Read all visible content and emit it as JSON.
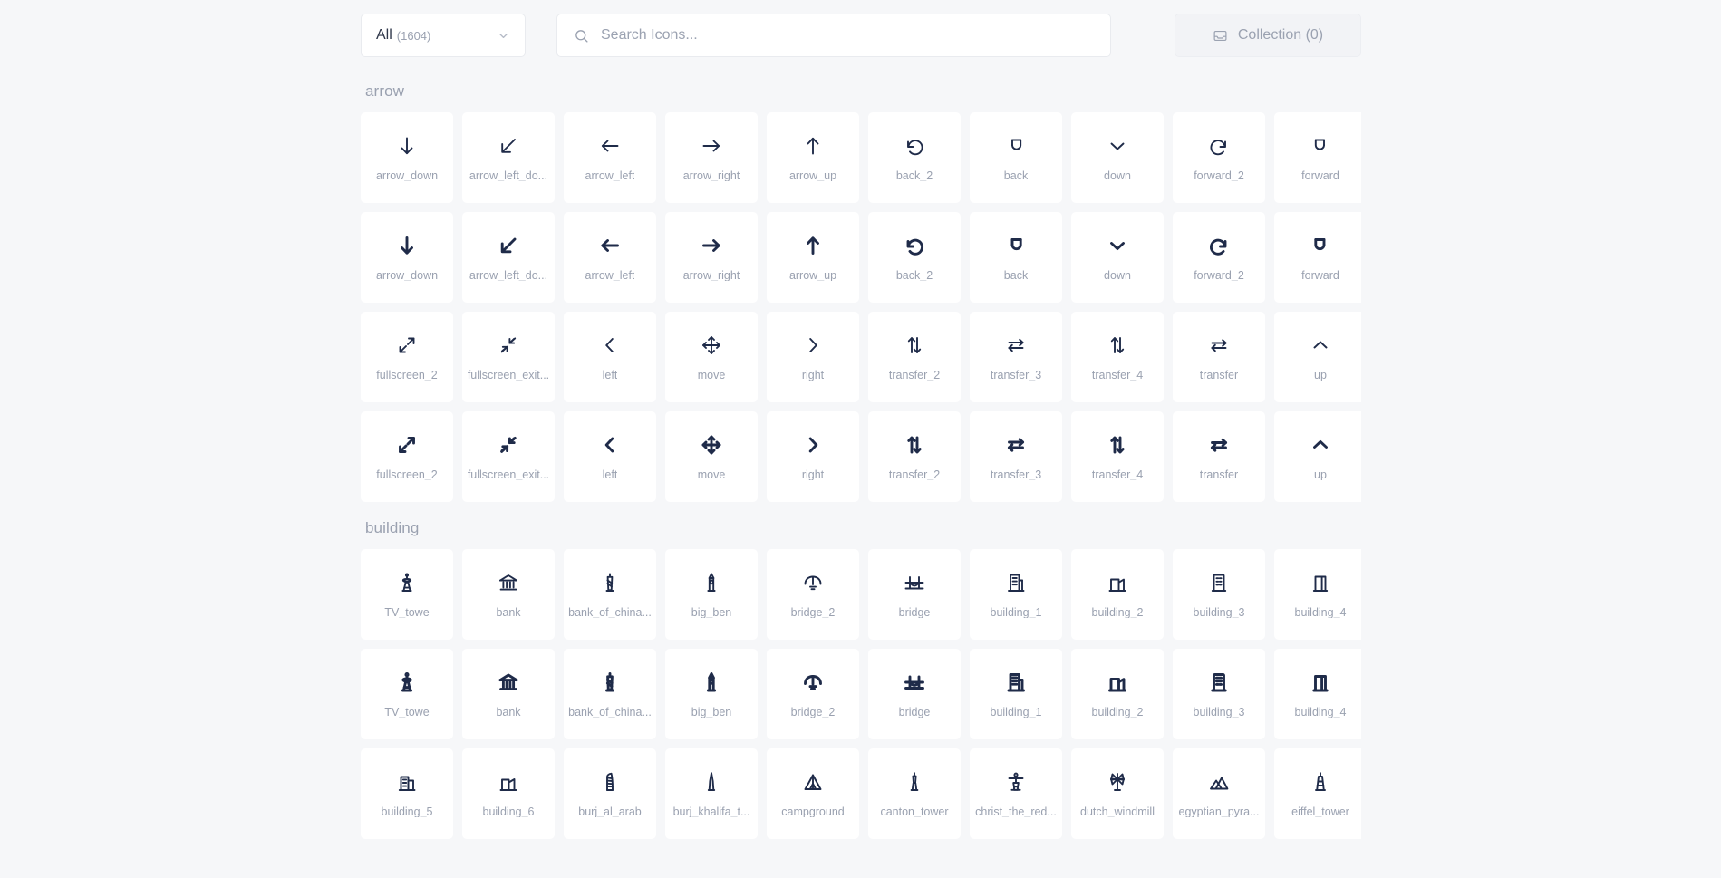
{
  "toolbar": {
    "filter": {
      "label": "All",
      "count": "(1604)",
      "caret_icon": "chevron-down-icon"
    },
    "search": {
      "placeholder": "Search Icons...",
      "value": "",
      "icon": "search-icon"
    },
    "collection": {
      "label": "Collection (0)",
      "icon": "inbox-icon"
    }
  },
  "sections": [
    {
      "title": "arrow",
      "rows": [
        {
          "style": "outline",
          "icons": [
            {
              "name": "arrow_down",
              "glyph": "arrow-down"
            },
            {
              "name": "arrow_left_do...",
              "glyph": "arrow-down-left"
            },
            {
              "name": "arrow_left",
              "glyph": "arrow-left"
            },
            {
              "name": "arrow_right",
              "glyph": "arrow-right"
            },
            {
              "name": "arrow_up",
              "glyph": "arrow-up"
            },
            {
              "name": "back_2",
              "glyph": "undo"
            },
            {
              "name": "back",
              "glyph": "back-loop"
            },
            {
              "name": "down",
              "glyph": "chevron-down"
            },
            {
              "name": "forward_2",
              "glyph": "redo"
            },
            {
              "name": "forward",
              "glyph": "forward-loop"
            }
          ]
        },
        {
          "style": "filled",
          "icons": [
            {
              "name": "arrow_down",
              "glyph": "arrow-down"
            },
            {
              "name": "arrow_left_do...",
              "glyph": "arrow-down-left"
            },
            {
              "name": "arrow_left",
              "glyph": "arrow-left"
            },
            {
              "name": "arrow_right",
              "glyph": "arrow-right"
            },
            {
              "name": "arrow_up",
              "glyph": "arrow-up"
            },
            {
              "name": "back_2",
              "glyph": "undo"
            },
            {
              "name": "back",
              "glyph": "back-loop"
            },
            {
              "name": "down",
              "glyph": "chevron-down"
            },
            {
              "name": "forward_2",
              "glyph": "redo"
            },
            {
              "name": "forward",
              "glyph": "forward-loop"
            }
          ]
        },
        {
          "style": "outline",
          "icons": [
            {
              "name": "fullscreen_2",
              "glyph": "fullscreen"
            },
            {
              "name": "fullscreen_exit...",
              "glyph": "fullscreen-exit"
            },
            {
              "name": "left",
              "glyph": "chevron-left"
            },
            {
              "name": "move",
              "glyph": "move"
            },
            {
              "name": "right",
              "glyph": "chevron-right"
            },
            {
              "name": "transfer_2",
              "glyph": "transfer-2"
            },
            {
              "name": "transfer_3",
              "glyph": "transfer-3"
            },
            {
              "name": "transfer_4",
              "glyph": "transfer-4"
            },
            {
              "name": "transfer",
              "glyph": "transfer"
            },
            {
              "name": "up",
              "glyph": "chevron-up"
            }
          ]
        },
        {
          "style": "filled",
          "icons": [
            {
              "name": "fullscreen_2",
              "glyph": "fullscreen"
            },
            {
              "name": "fullscreen_exit...",
              "glyph": "fullscreen-exit"
            },
            {
              "name": "left",
              "glyph": "chevron-left"
            },
            {
              "name": "move",
              "glyph": "move"
            },
            {
              "name": "right",
              "glyph": "chevron-right"
            },
            {
              "name": "transfer_2",
              "glyph": "transfer-2"
            },
            {
              "name": "transfer_3",
              "glyph": "transfer-3"
            },
            {
              "name": "transfer_4",
              "glyph": "transfer-4"
            },
            {
              "name": "transfer",
              "glyph": "transfer"
            },
            {
              "name": "up",
              "glyph": "chevron-up"
            }
          ]
        }
      ]
    },
    {
      "title": "building",
      "rows": [
        {
          "style": "outline",
          "icons": [
            {
              "name": "TV_towe",
              "glyph": "tv-tower"
            },
            {
              "name": "bank",
              "glyph": "bank"
            },
            {
              "name": "bank_of_china...",
              "glyph": "bank-of-china"
            },
            {
              "name": "big_ben",
              "glyph": "big-ben"
            },
            {
              "name": "bridge_2",
              "glyph": "bridge-2"
            },
            {
              "name": "bridge",
              "glyph": "bridge"
            },
            {
              "name": "building_1",
              "glyph": "building-1"
            },
            {
              "name": "building_2",
              "glyph": "building-2"
            },
            {
              "name": "building_3",
              "glyph": "building-3"
            },
            {
              "name": "building_4",
              "glyph": "building-4"
            }
          ]
        },
        {
          "style": "filled",
          "icons": [
            {
              "name": "TV_towe",
              "glyph": "tv-tower"
            },
            {
              "name": "bank",
              "glyph": "bank"
            },
            {
              "name": "bank_of_china...",
              "glyph": "bank-of-china"
            },
            {
              "name": "big_ben",
              "glyph": "big-ben"
            },
            {
              "name": "bridge_2",
              "glyph": "bridge-2"
            },
            {
              "name": "bridge",
              "glyph": "bridge"
            },
            {
              "name": "building_1",
              "glyph": "building-1"
            },
            {
              "name": "building_2",
              "glyph": "building-2"
            },
            {
              "name": "building_3",
              "glyph": "building-3"
            },
            {
              "name": "building_4",
              "glyph": "building-4"
            }
          ]
        },
        {
          "style": "outline",
          "icons": [
            {
              "name": "building_5",
              "glyph": "building-5"
            },
            {
              "name": "building_6",
              "glyph": "building-6"
            },
            {
              "name": "burj_al_arab",
              "glyph": "burj-al-arab"
            },
            {
              "name": "burj_khalifa_t...",
              "glyph": "burj-khalifa"
            },
            {
              "name": "campground",
              "glyph": "campground"
            },
            {
              "name": "canton_tower",
              "glyph": "canton-tower"
            },
            {
              "name": "christ_the_red...",
              "glyph": "christ-redeemer"
            },
            {
              "name": "dutch_windmill",
              "glyph": "windmill"
            },
            {
              "name": "egyptian_pyra...",
              "glyph": "pyramid"
            },
            {
              "name": "eiffel_tower",
              "glyph": "eiffel-tower"
            }
          ]
        }
      ]
    }
  ],
  "colors": {
    "background": "#f6f7f9",
    "card": "#ffffff",
    "icon": "#1f2b49",
    "label": "#9aa1b0"
  }
}
